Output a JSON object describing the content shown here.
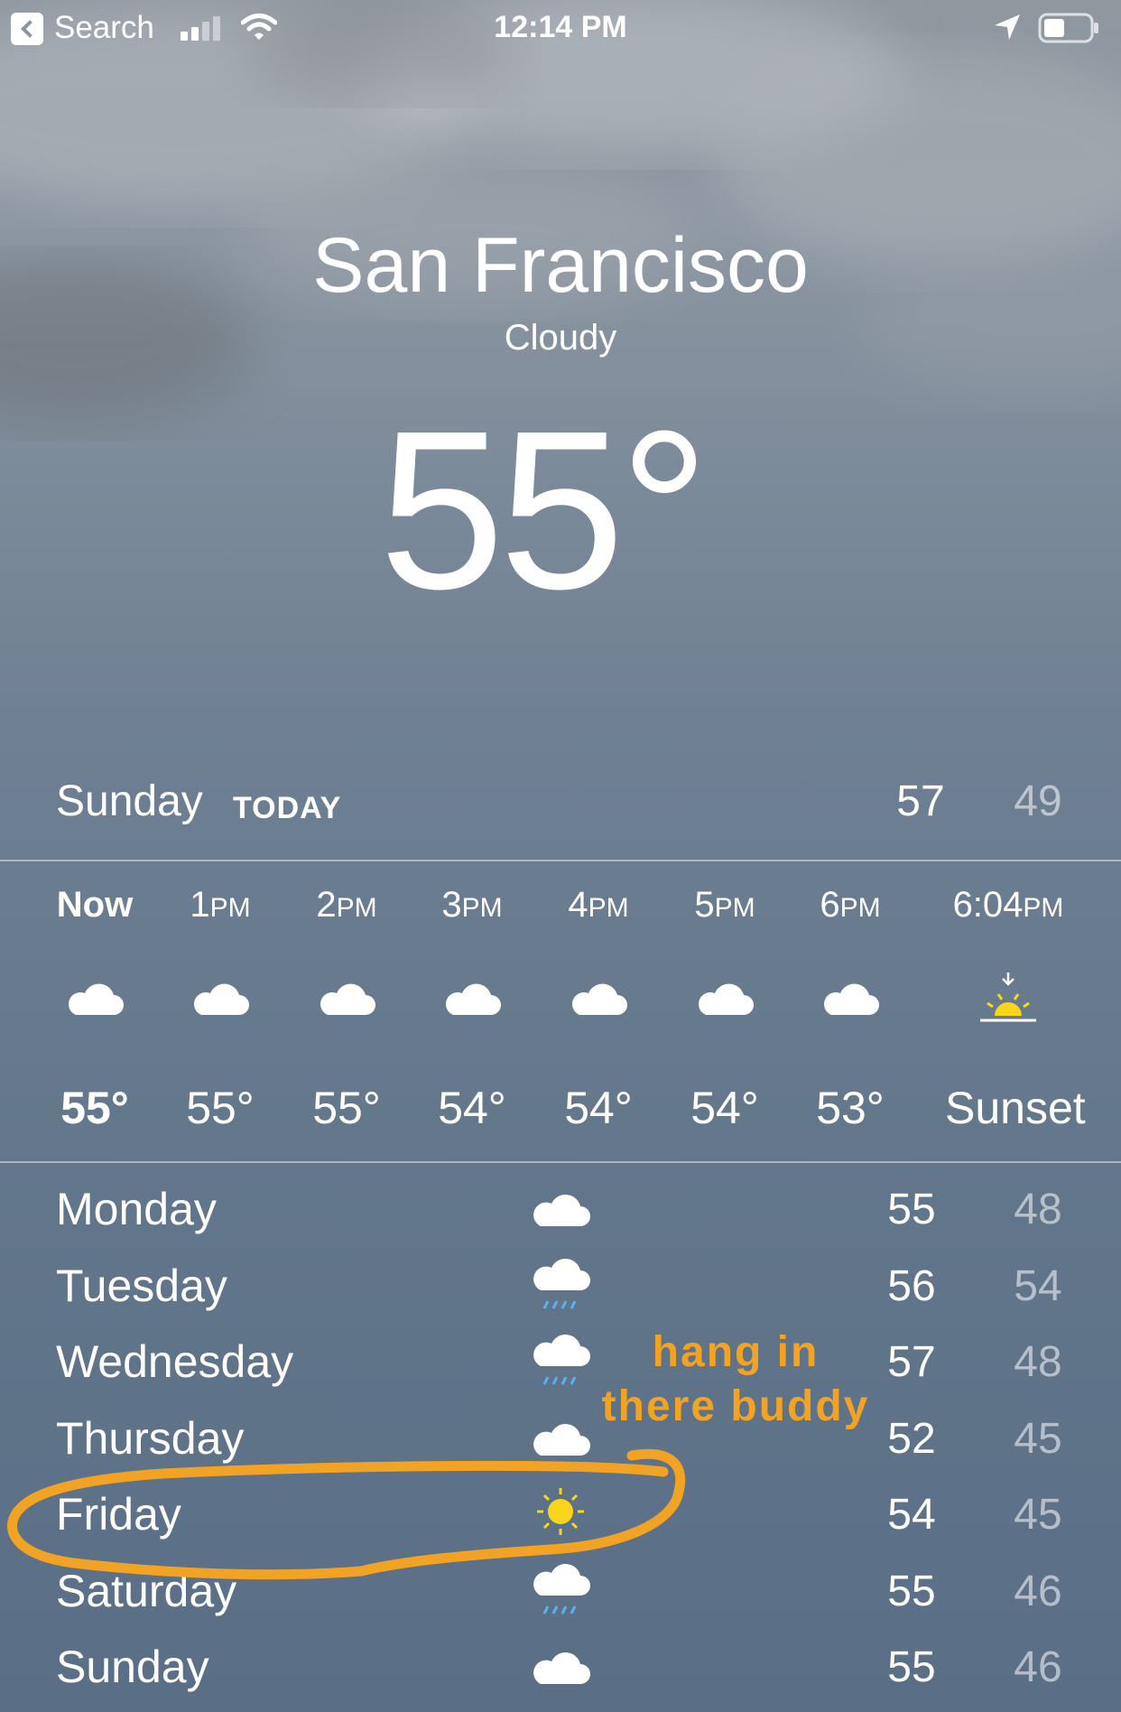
{
  "status_bar": {
    "back_label": "Search",
    "time": "12:14 PM"
  },
  "location": {
    "city": "San Francisco",
    "condition": "Cloudy",
    "temperature": "55°"
  },
  "today": {
    "day": "Sunday",
    "tag": "TODAY",
    "high": "57",
    "low": "49"
  },
  "hourly": [
    {
      "time": "Now",
      "ampm": "",
      "icon": "cloud-icon",
      "temp": "55°"
    },
    {
      "time": "1",
      "ampm": "PM",
      "icon": "cloud-icon",
      "temp": "55°"
    },
    {
      "time": "2",
      "ampm": "PM",
      "icon": "cloud-icon",
      "temp": "55°"
    },
    {
      "time": "3",
      "ampm": "PM",
      "icon": "cloud-icon",
      "temp": "54°"
    },
    {
      "time": "4",
      "ampm": "PM",
      "icon": "cloud-icon",
      "temp": "54°"
    },
    {
      "time": "5",
      "ampm": "PM",
      "icon": "cloud-icon",
      "temp": "54°"
    },
    {
      "time": "6",
      "ampm": "PM",
      "icon": "cloud-icon",
      "temp": "53°"
    },
    {
      "time": "6:04",
      "ampm": "PM",
      "icon": "sunset-icon",
      "temp": "Sunset"
    }
  ],
  "daily": [
    {
      "day": "Monday",
      "icon": "cloud-icon",
      "high": "55",
      "low": "48"
    },
    {
      "day": "Tuesday",
      "icon": "cloud-rain-icon",
      "high": "56",
      "low": "54"
    },
    {
      "day": "Wednesday",
      "icon": "cloud-rain-icon",
      "high": "57",
      "low": "48"
    },
    {
      "day": "Thursday",
      "icon": "cloud-icon",
      "high": "52",
      "low": "45"
    },
    {
      "day": "Friday",
      "icon": "sun-icon",
      "high": "54",
      "low": "45"
    },
    {
      "day": "Saturday",
      "icon": "cloud-rain-icon",
      "high": "55",
      "low": "46"
    },
    {
      "day": "Sunday",
      "icon": "cloud-icon",
      "high": "55",
      "low": "46"
    }
  ],
  "annotation": {
    "line1": "hang in",
    "line2": "there buddy",
    "color": "#f2a324"
  },
  "colors": {
    "sun": "#f9d51b",
    "rain": "#5ab1f2"
  }
}
